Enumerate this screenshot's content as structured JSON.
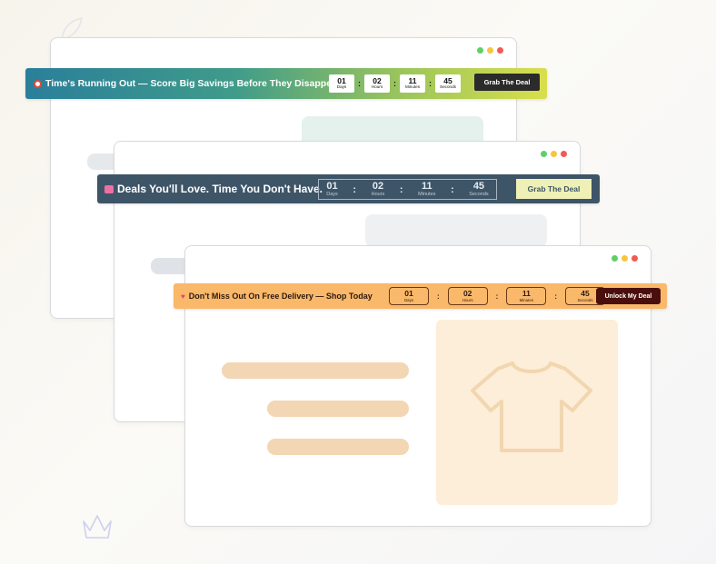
{
  "banners": [
    {
      "text": "Time's Running Out — Score Big Savings Before They Disappear!",
      "icon": "alarm-clock-icon",
      "counter": [
        {
          "value": "01",
          "label": "Days"
        },
        {
          "value": "02",
          "label": "Hours"
        },
        {
          "value": "11",
          "label": "Minutes"
        },
        {
          "value": "45",
          "label": "Seconds"
        }
      ],
      "separator": ":",
      "cta": "Grab The Deal"
    },
    {
      "text": "Deals You'll Love. Time You Don't Have.",
      "icon": "shopping-bag-icon",
      "counter": [
        {
          "value": "01",
          "label": "Days"
        },
        {
          "value": "02",
          "label": "Hours"
        },
        {
          "value": "11",
          "label": "Minutes"
        },
        {
          "value": "45",
          "label": "Seconds"
        }
      ],
      "separator": ":",
      "cta": "Grab The Deal"
    },
    {
      "text": "Don't Miss Out On Free Delivery — Shop Today",
      "icon": "heart-icon",
      "counter": [
        {
          "value": "01",
          "label": "Days"
        },
        {
          "value": "02",
          "label": "Hours"
        },
        {
          "value": "11",
          "label": "Minutes"
        },
        {
          "value": "45",
          "label": "Seconds"
        }
      ],
      "separator": ":",
      "cta": "Unlock My Deal"
    }
  ],
  "window_controls": [
    "green-dot",
    "yellow-dot",
    "red-dot"
  ],
  "colors": {
    "banner1_start": "#2a7f9a",
    "banner1_end": "#d9df4c",
    "banner2_bg": "#3e5568",
    "banner2_cta_bg": "#eef0b5",
    "banner3_bg": "#f9b86a",
    "banner3_cta_bg": "#4a0f0c",
    "placeholder_bar": "#f3d6b3",
    "product_card": "#fdeed9"
  },
  "product_icon": "tshirt-icon"
}
